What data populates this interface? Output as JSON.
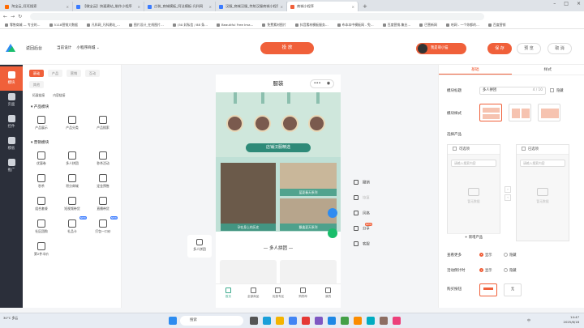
{
  "browser": {
    "tabs": [
      {
        "label": "淘宝云_旺旺搜索",
        "color": "#ff6a00"
      },
      {
        "label": "【微宝云】快速建站_制作小程序",
        "color": "#3a7bff"
      },
      {
        "label": "古装_商城模板_阿法模板-凡科网",
        "color": "#3a7bff"
      },
      {
        "label": "汉服_商城汉服_传统汉服商城小程序",
        "color": "#3a7bff"
      },
      {
        "label": "商城小程序",
        "color": "#f0603a",
        "active": true
      }
    ],
    "new_tab": "+",
    "bookmarks": [
      "零售商城 — 专业的…",
      "5118营销大数据",
      "凡科网_凡科建站_…",
      "图片设计_在线图片…",
      "(50 封私信 / 88 条…",
      "Beautiful Free Ima…",
      "免费素材图片",
      "抖音素材模板服务…",
      "布本本中模板网 - 免…",
      "百度营销-集业…",
      "巴营新网",
      "哈网 - 一个你都的…",
      "百度营销",
      ""
    ]
  },
  "header": {
    "back": "返回后台",
    "current_label": "当前设计",
    "current_value": "小程序商城",
    "publish": "投 放",
    "vip": "我是萌小猫",
    "save": "保 存",
    "preview": "预 览",
    "cancel": "取 消"
  },
  "rail": [
    {
      "label": "模块",
      "active": true
    },
    {
      "label": "页面"
    },
    {
      "label": "控件"
    },
    {
      "label": "模板"
    },
    {
      "label": "推广"
    }
  ],
  "panel": {
    "tabs": [
      "基础",
      "产品",
      "营销",
      "互动",
      "其他"
    ],
    "subtabs": [
      "拓展链接",
      "内容链接"
    ],
    "groups": [
      {
        "title": "产品模块",
        "items": [
          {
            "label": "产品展示"
          },
          {
            "label": "产品分类"
          },
          {
            "label": "产品搜索"
          }
        ]
      },
      {
        "title": "营销模块",
        "items": [
          {
            "label": "优惠卷"
          },
          {
            "label": "多人拼团"
          },
          {
            "label": "秒杀活动"
          },
          {
            "label": "秒杀"
          },
          {
            "label": "积分商城"
          },
          {
            "label": "定金预售"
          },
          {
            "label": "组合套餐"
          },
          {
            "label": "短视频带货"
          },
          {
            "label": "直播带货"
          },
          {
            "label": "社区团购"
          },
          {
            "label": "礼品卡",
            "badge": "NEW"
          },
          {
            "label": "打包一口价",
            "badge": "NEW"
          },
          {
            "label": "第2件半价"
          }
        ]
      }
    ]
  },
  "canvas": {
    "side_chip": "多人拼团",
    "phone": {
      "title": "服装",
      "capsule_dots": "•••",
      "banner_label": "店铺汉服精选",
      "gallery": [
        {
          "caption": "孕在身上的历史"
        },
        {
          "caption": "蓝夏春天系列"
        },
        {
          "caption": "飘逸夏天系列"
        }
      ],
      "section_title": "多人拼团",
      "tabbar": [
        {
          "label": "首页",
          "active": true
        },
        {
          "label": "全部商品"
        },
        {
          "label": "优惠专区"
        },
        {
          "label": "购物车"
        },
        {
          "label": "我的"
        }
      ]
    },
    "tools": [
      {
        "label": "撤销"
      },
      {
        "label": "恢复",
        "disabled": true
      },
      {
        "label": "风格"
      },
      {
        "label": "分享",
        "badge": "NEW"
      },
      {
        "label": "客服"
      }
    ]
  },
  "right": {
    "tabs": [
      "基础",
      "样式"
    ],
    "title_label": "模块标题",
    "title_value": "多人拼团",
    "title_count": "4 / 10",
    "hide_label": "隐藏",
    "style_label": "模块样式",
    "select_label": "选择产品",
    "left_box": "可选项",
    "right_box": "已选项",
    "search_placeholder": "请输入搜索内容",
    "empty": "暂无数据",
    "add": "+ 新增产品",
    "more_label": "查看更多",
    "show": "显示",
    "hide": "隐藏",
    "countdown_label": "活动倒计时",
    "buy_label": "购买按钮",
    "buy_none": "无"
  },
  "taskbar": {
    "weather": "30°C 多云",
    "search": "搜索",
    "time": "14:47",
    "date": "2025/6/18",
    "ime": "中"
  }
}
